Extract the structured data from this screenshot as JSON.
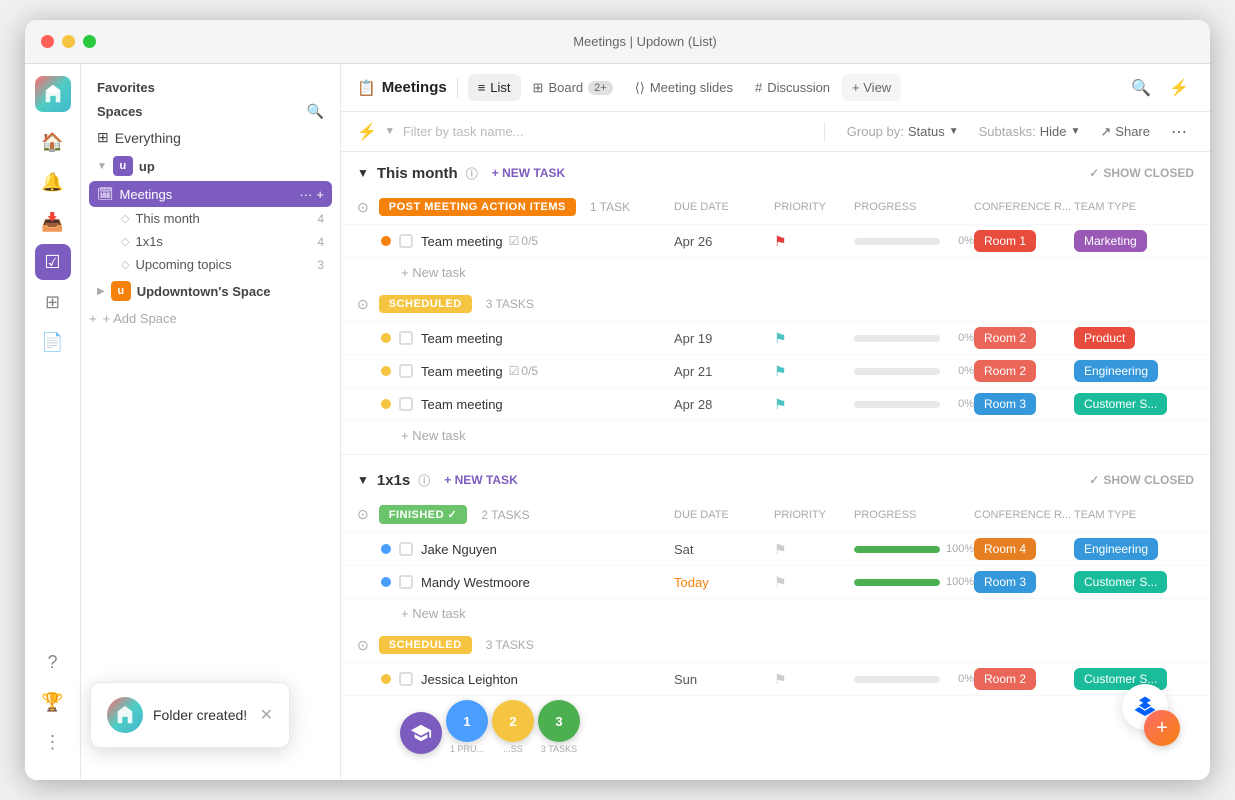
{
  "window": {
    "title": "Meetings | Updown (List)"
  },
  "titlebar": {
    "dots": [
      "red",
      "yellow",
      "green"
    ]
  },
  "sidebar": {
    "favorites_label": "Favorites",
    "spaces_label": "Spaces",
    "everything_label": "Everything",
    "spaces": [
      {
        "id": "up",
        "label": "up",
        "avatar": "u",
        "color": "purple",
        "expanded": true,
        "items": [
          {
            "id": "meetings",
            "label": "Meetings",
            "active": true,
            "sub_items": [
              {
                "id": "this-month",
                "label": "This month",
                "count": "4"
              },
              {
                "id": "1x1s",
                "label": "1x1s",
                "count": "4"
              },
              {
                "id": "upcoming-topics",
                "label": "Upcoming topics",
                "count": "3"
              }
            ]
          }
        ]
      },
      {
        "id": "updownspace",
        "label": "Updowntown's Space",
        "avatar": "u",
        "color": "orange",
        "expanded": false
      }
    ],
    "add_space_label": "+ Add Space"
  },
  "toolbar": {
    "page_icon": "📋",
    "page_title": "Meetings",
    "tabs": [
      {
        "id": "list",
        "label": "List",
        "icon": "≡",
        "active": true
      },
      {
        "id": "board",
        "label": "Board",
        "icon": "⊞",
        "badge": "2+"
      },
      {
        "id": "meeting-slides",
        "label": "Meeting slides",
        "icon": "⟨⟩"
      },
      {
        "id": "discussion",
        "label": "Discussion",
        "icon": "#"
      }
    ],
    "add_view_label": "+ View",
    "share_label": "Share"
  },
  "filter_bar": {
    "filter_placeholder": "Filter by task name...",
    "group_by_label": "Group by:",
    "group_by_value": "Status",
    "subtasks_label": "Subtasks:",
    "subtasks_value": "Hide",
    "share_label": "Share"
  },
  "sections": [
    {
      "id": "this-month",
      "label": "This month",
      "new_task_label": "+ NEW TASK",
      "show_closed_label": "SHOW CLOSED",
      "groups": [
        {
          "id": "post-meeting",
          "status_label": "POST MEETING ACTION ITEMS",
          "status_class": "badge-post",
          "task_count_label": "1 TASK",
          "tasks": [
            {
              "id": "tm1",
              "name": "Team meeting",
              "subtask_label": "0/5",
              "due": "Apr 26",
              "priority": "red",
              "progress": 0,
              "conf_room": "Room 1",
              "conf_class": "conf-room1",
              "team": "Marketing",
              "team_class": "team-marketing",
              "dot_class": "dot-orange"
            }
          ]
        },
        {
          "id": "scheduled",
          "status_label": "SCHEDULED",
          "status_class": "badge-scheduled",
          "task_count_label": "3 TASKS",
          "tasks": [
            {
              "id": "tm2",
              "name": "Team meeting",
              "subtask_label": "",
              "due": "Apr 19",
              "priority": "teal",
              "progress": 0,
              "conf_room": "Room 2",
              "conf_class": "conf-room2",
              "team": "Product",
              "team_class": "team-product",
              "dot_class": "dot-yellow"
            },
            {
              "id": "tm3",
              "name": "Team meeting",
              "subtask_label": "0/5",
              "due": "Apr 21",
              "priority": "teal",
              "progress": 0,
              "conf_room": "Room 2",
              "conf_class": "conf-room2",
              "team": "Engineering",
              "team_class": "team-engineering",
              "dot_class": "dot-yellow"
            },
            {
              "id": "tm4",
              "name": "Team meeting",
              "subtask_label": "",
              "due": "Apr 28",
              "priority": "teal",
              "progress": 0,
              "conf_room": "Room 3",
              "conf_class": "conf-room3",
              "team": "Customer S...",
              "team_class": "team-customer",
              "dot_class": "dot-yellow"
            }
          ]
        }
      ]
    },
    {
      "id": "1x1s",
      "label": "1x1s",
      "new_task_label": "+ NEW TASK",
      "show_closed_label": "SHOW CLOSED",
      "groups": [
        {
          "id": "finished",
          "status_label": "FINISHED",
          "status_class": "badge-finished",
          "task_count_label": "2 TASKS",
          "tasks": [
            {
              "id": "jn1",
              "name": "Jake Nguyen",
              "subtask_label": "",
              "due": "Sat",
              "due_class": "",
              "priority": "gray",
              "progress": 100,
              "progress_class": "progress-green",
              "conf_room": "Room 4",
              "conf_class": "conf-room4",
              "team": "Engineering",
              "team_class": "team-engineering",
              "dot_class": "dot-blue"
            },
            {
              "id": "mw1",
              "name": "Mandy Westmoore",
              "subtask_label": "",
              "due": "Today",
              "due_class": "today",
              "priority": "gray",
              "progress": 100,
              "progress_class": "progress-green",
              "conf_room": "Room 3",
              "conf_class": "conf-room3",
              "team": "Customer S...",
              "team_class": "team-customer",
              "dot_class": "dot-blue"
            }
          ]
        },
        {
          "id": "scheduled2",
          "status_label": "SCHEDULED",
          "status_class": "badge-scheduled",
          "task_count_label": "3 TASKS",
          "tasks": [
            {
              "id": "jl1",
              "name": "Jessica Leighton",
              "subtask_label": "",
              "due": "Sun",
              "due_class": "",
              "priority": "gray",
              "progress": 0,
              "progress_class": "progress-light",
              "conf_room": "Room 2",
              "conf_class": "conf-room2",
              "team": "Customer S...",
              "team_class": "team-customer",
              "dot_class": "dot-yellow"
            }
          ]
        }
      ]
    }
  ],
  "columns": {
    "due_date": "DUE DATE",
    "priority": "PRIORITY",
    "progress": "PROGRESS",
    "conference": "CONFERENCE R...",
    "team": "TEAM TYPE"
  },
  "toast": {
    "message": "Folder created!"
  },
  "fab": {
    "labels": [
      "1 PRU...",
      "...SS",
      "3 TASKS"
    ]
  }
}
